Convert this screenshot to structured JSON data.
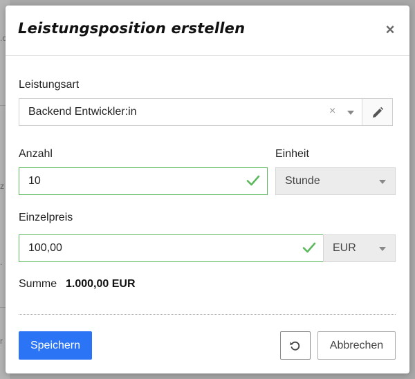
{
  "background": {
    "fragments": [
      ".c",
      "z",
      ".",
      "r"
    ]
  },
  "dialog": {
    "title": "Leistungsposition erstellen",
    "close_icon": "×"
  },
  "leistungsart": {
    "label": "Leistungsart",
    "value": "Backend Entwickler:in",
    "clear_icon": "×"
  },
  "anzahl": {
    "label": "Anzahl",
    "value": "10"
  },
  "einheit": {
    "label": "Einheit",
    "value": "Stunde"
  },
  "einzelpreis": {
    "label": "Einzelpreis",
    "value": "100,00",
    "currency": "EUR"
  },
  "summe": {
    "label": "Summe",
    "value": "1.000,00 EUR"
  },
  "footer": {
    "save_label": "Speichern",
    "cancel_label": "Abbrechen"
  },
  "colors": {
    "primary": "#2a74f5",
    "valid": "#5cb85c"
  },
  "icons": {
    "close": "close-icon",
    "clear": "clear-icon",
    "dropdown": "chevron-down-icon",
    "edit": "pencil-icon",
    "valid": "checkmark-icon",
    "reset": "undo-icon"
  }
}
